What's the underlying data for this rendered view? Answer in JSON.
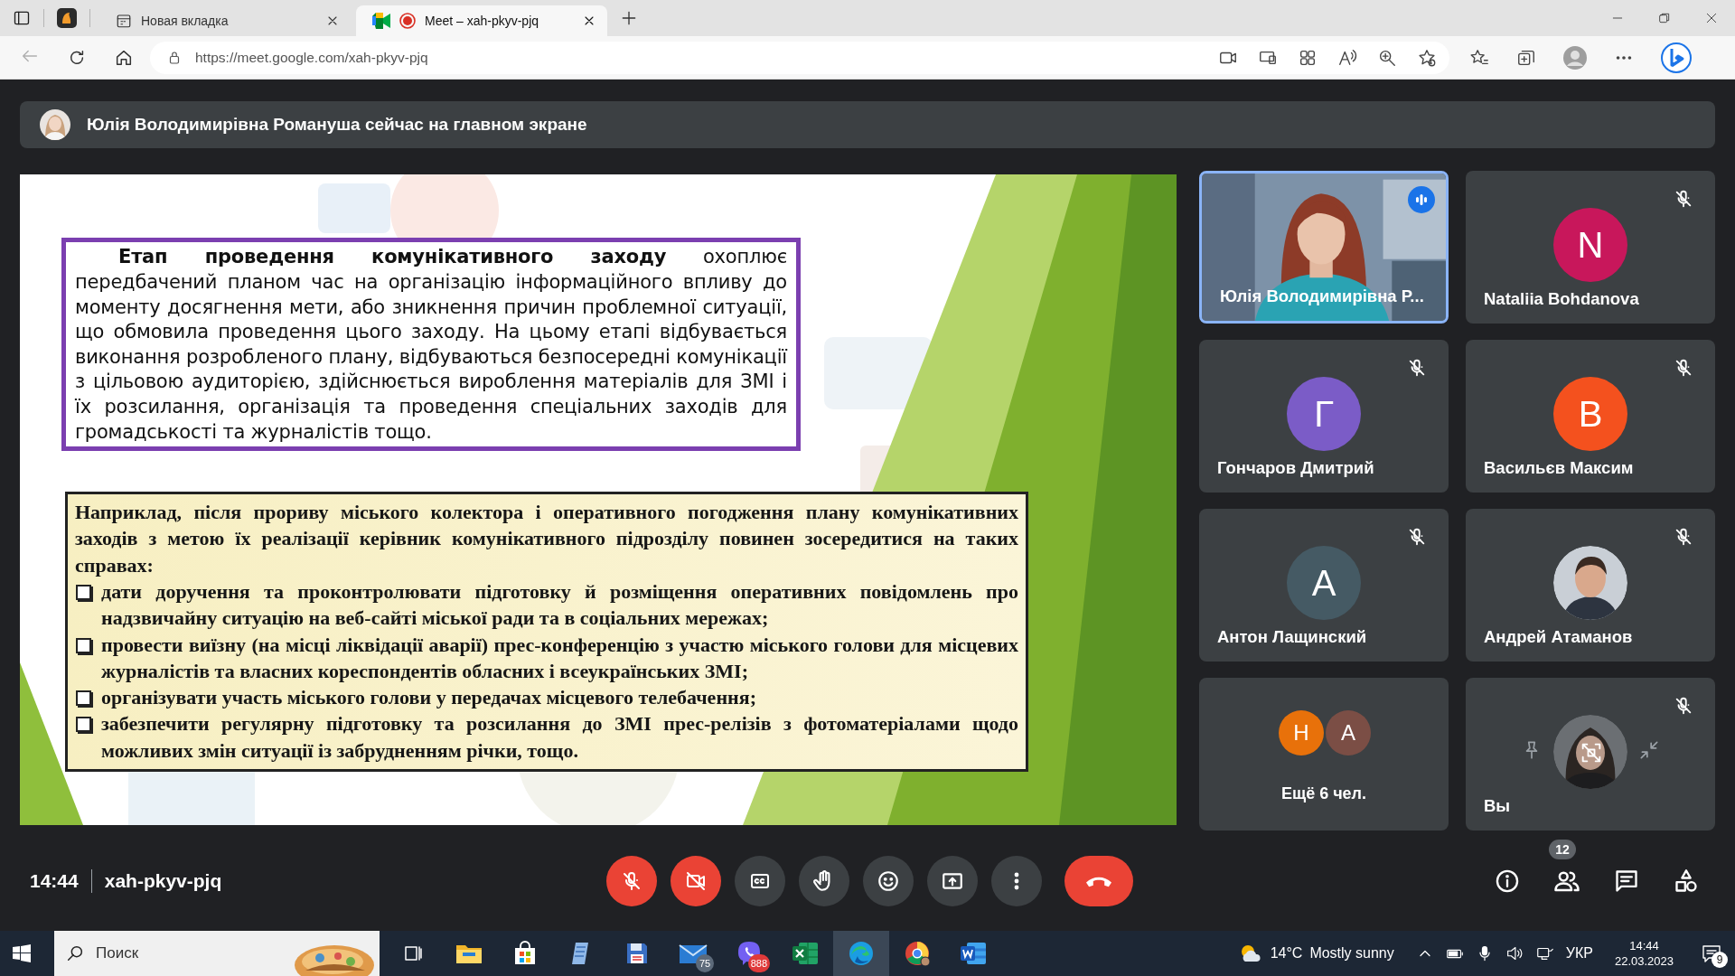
{
  "browser": {
    "tabs": [
      {
        "kind": "new-tab",
        "title": "Новая вкладка",
        "selected": false,
        "recording": false
      },
      {
        "kind": "meet",
        "title": "Meet – xah-pkyv-pjq",
        "selected": true,
        "recording": true
      }
    ],
    "url": "https://meet.google.com/xah-pkyv-pjq"
  },
  "banner": {
    "text": "Юлія Володимирівна Романуша сейчас на главном экране"
  },
  "slide": {
    "intro": "**Етап проведення комунікативного заходу** охоплює передбачений планом час на організацію інформаційного впливу до моменту досягнення мети, або зникнення причин проблемної ситуації, що обмовила проведення цього заходу. На цьому етапі відбувається виконання розробленого плану, відбуваються безпосередні комунікації з цільовою аудиторією, здійснюється вироблення матеріалів для ЗМІ і їх розсилання, організація та проведення спеціальних заходів для громадськості та журналістів тощо.",
    "example": "Наприклад, після прориву міського колектора і оперативного погодження плану комунікативних заходів з метою їх реалізації керівник комунікативного підрозділу повинен зосередитися на таких справах:",
    "bullets": [
      "дати доручення та проконтролювати підготовку й розміщення оперативних повідомлень про надзвичайну ситуацію на веб-сайті міської ради та в соціальних мережах;",
      "провести виїзну (на місці ліквідації аварії) прес-конференцію з участю міського голови для місцевих журналістів та власних кореспондентів обласних і всеукраїнських ЗМІ;",
      "організувати участь міського голови у передачах місцевого телебачення;",
      "забезпечити регулярну підготовку та розсилання до ЗМІ прес-релізів з фотоматеріалами щодо можливих змін ситуації із забрудненням річки, тощо."
    ]
  },
  "participants": [
    {
      "kind": "video",
      "name": "Юлія Володимирівна Р...",
      "muted": false,
      "speaking": true
    },
    {
      "kind": "initial",
      "name": "Nataliia Bohdanova",
      "initial": "N",
      "color": "#c8175b",
      "muted": true,
      "speaking": false
    },
    {
      "kind": "initial",
      "name": "Гончаров Дмитрий",
      "initial": "Г",
      "color": "#7b5cc7",
      "muted": true,
      "speaking": false
    },
    {
      "kind": "initial",
      "name": "Васильєв Максим",
      "initial": "В",
      "color": "#f4511e",
      "muted": true,
      "speaking": false
    },
    {
      "kind": "initial",
      "name": "Антон Лащинский",
      "initial": "А",
      "color": "#455a64",
      "muted": true,
      "speaking": false
    },
    {
      "name": "Андрей Атаманов",
      "muted": true,
      "speaking": false
    },
    {
      "kind": "others",
      "name": "Ещё 6 чел.",
      "avatars": [
        {
          "initial": "Н",
          "color": "#e8710a"
        },
        {
          "initial": "А",
          "color": "#7b4e45"
        }
      ],
      "muted": false,
      "speaking": false
    },
    {
      "kind": "self",
      "name": "Вы",
      "muted": true,
      "speaking": false
    }
  ],
  "controls": {
    "time": "14:44",
    "meeting_code": "xah-pkyv-pjq",
    "buttons": [
      {
        "kind": "mic",
        "on": false
      },
      {
        "kind": "camera",
        "on": false
      },
      {
        "kind": "captions"
      },
      {
        "kind": "hand"
      },
      {
        "kind": "emoji"
      },
      {
        "kind": "present"
      },
      {
        "kind": "more"
      },
      {
        "kind": "leave"
      }
    ],
    "people_count": "12"
  },
  "taskbar": {
    "search_placeholder": "Поиск",
    "apps": [
      {
        "kind": "taskview",
        "selected": false
      },
      {
        "kind": "explorer",
        "selected": false
      },
      {
        "kind": "store",
        "selected": false
      },
      {
        "kind": "notepad",
        "selected": false
      },
      {
        "kind": "save",
        "selected": false
      },
      {
        "kind": "mail",
        "selected": false,
        "badge": "75"
      },
      {
        "kind": "viber",
        "selected": false,
        "badge": "888"
      },
      {
        "kind": "excel",
        "selected": false
      },
      {
        "kind": "edge",
        "selected": true
      },
      {
        "kind": "chrome",
        "selected": false
      },
      {
        "kind": "word",
        "selected": false
      }
    ],
    "weather": {
      "temperature": "14°C",
      "condition": "Mostly sunny"
    },
    "language": "УКР",
    "time": "14:44",
    "date": "22.03.2023",
    "notifications": "9"
  }
}
